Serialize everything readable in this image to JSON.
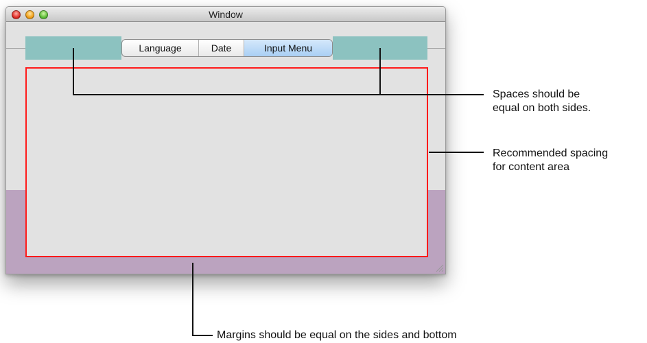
{
  "window": {
    "title": "Window",
    "tabs": [
      "Language",
      "Date",
      "Input Menu"
    ],
    "selected_tab": "Input Menu"
  },
  "callouts": {
    "spaces_line1": "Spaces should be",
    "spaces_line2": "equal on both sides.",
    "spacing_line1": "Recommended spacing",
    "spacing_line2": "for content area",
    "margins": "Margins should be equal on the sides and bottom"
  },
  "colors": {
    "spacer_highlight": "#8cc2c0",
    "content_outline": "#ff1a1a",
    "margin_highlight": "#bba3bf",
    "selected_tab": "#a9cff4"
  }
}
